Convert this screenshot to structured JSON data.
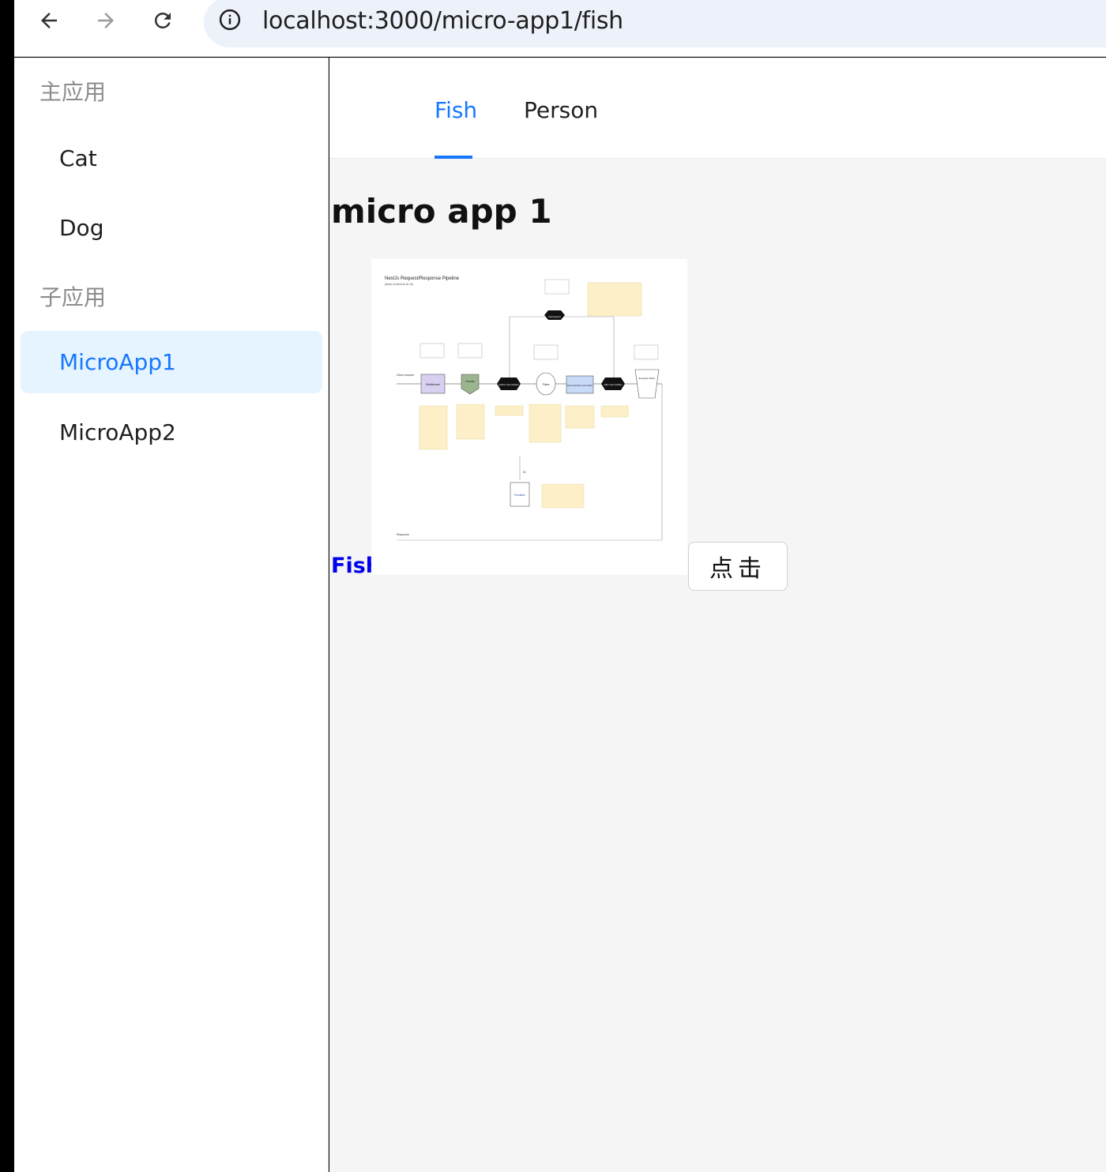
{
  "browser": {
    "url": "localhost:3000/micro-app1/fish"
  },
  "sidebar": {
    "groups": [
      {
        "title": "主应用",
        "items": [
          {
            "label": "Cat"
          },
          {
            "label": "Dog"
          }
        ]
      },
      {
        "title": "子应用",
        "items": [
          {
            "label": "MicroApp1",
            "active": true
          },
          {
            "label": "MicroApp2"
          }
        ]
      }
    ]
  },
  "tabs": [
    {
      "label": "Fish",
      "active": true
    },
    {
      "label": "Person"
    }
  ],
  "main": {
    "heading": "micro app 1",
    "link": "Fish",
    "button": "点击"
  },
  "diagram": {
    "title": "NestJs Request/Response Pipeline",
    "subtitle": "(faster at NestJs v6.10)",
    "client_request": "Client request",
    "response": "Response",
    "nodes": {
      "middleware": "Middleware",
      "guards": "Guards",
      "interceptors": "Interceptors",
      "before": "(before route handler)",
      "pipes": "Pipes",
      "route_handler": "Route Handler (controller)",
      "after": "(after route handler)",
      "exception_filters": "Exception Filters",
      "providers": "Providers",
      "di": "DI"
    },
    "colors": {
      "note": "#fdf0c8",
      "middleware": "#d9cff0",
      "guard": "#9bb58f",
      "route": "#c7daf7",
      "black": "#111111"
    }
  },
  "colors": {
    "accent": "#1677ff",
    "active_bg": "#e6f4ff",
    "link": "#0000ee"
  }
}
